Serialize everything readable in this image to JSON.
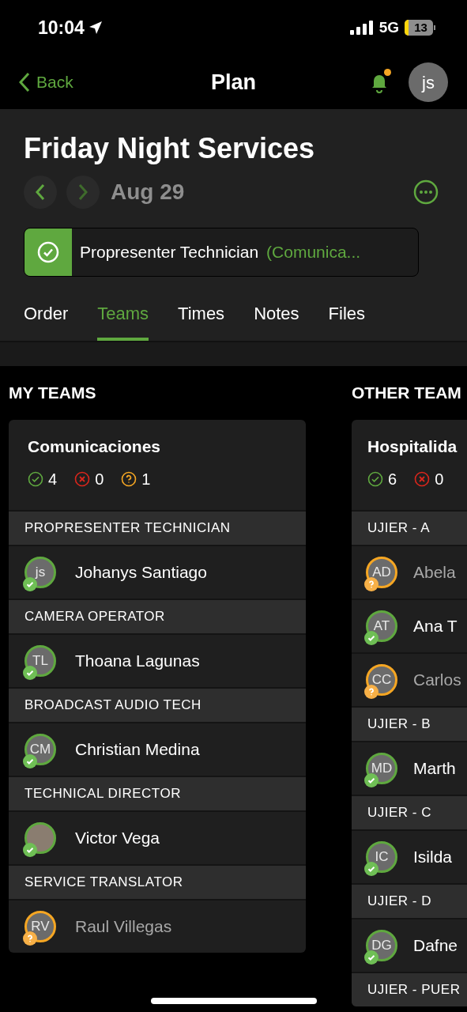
{
  "status_bar": {
    "time": "10:04",
    "network": "5G",
    "battery": "13"
  },
  "nav": {
    "back": "Back",
    "title": "Plan",
    "avatar": "js",
    "notification": true
  },
  "plan": {
    "title": "Friday Night Services",
    "date": "Aug 29",
    "date_nav": [
      {
        "kind": "prev",
        "disabled": false
      },
      {
        "kind": "next",
        "disabled": true
      }
    ],
    "assignment": {
      "kind": "confirmed",
      "position": "Propresenter Technician",
      "team": "(Comunica..."
    }
  },
  "tabs": [
    {
      "label": "Order",
      "selected": false
    },
    {
      "label": "Teams",
      "selected": true
    },
    {
      "label": "Times",
      "selected": false
    },
    {
      "label": "Notes",
      "selected": false
    },
    {
      "label": "Files",
      "selected": false
    }
  ],
  "columns": [
    {
      "heading": "MY TEAMS",
      "teams": [
        {
          "name": "Comunicaciones",
          "counts": [
            {
              "kind": "confirmed",
              "value": "4"
            },
            {
              "kind": "declined",
              "value": "0"
            },
            {
              "kind": "pending",
              "value": "1"
            }
          ],
          "positions": [
            {
              "name": "PROPRESENTER TECHNICIAN",
              "members": [
                {
                  "name": "Johanys Santiago",
                  "initials": "js",
                  "kind": "confirmed",
                  "photo": false
                }
              ]
            },
            {
              "name": "CAMERA OPERATOR",
              "members": [
                {
                  "name": "Thoana Lagunas",
                  "initials": "TL",
                  "kind": "confirmed",
                  "photo": false
                }
              ]
            },
            {
              "name": "BROADCAST AUDIO TECH",
              "members": [
                {
                  "name": "Christian Medina",
                  "initials": "CM",
                  "kind": "confirmed",
                  "photo": false
                }
              ]
            },
            {
              "name": "TECHNICAL DIRECTOR",
              "members": [
                {
                  "name": "Victor Vega",
                  "kind": "confirmed",
                  "photo": true
                }
              ]
            },
            {
              "name": "SERVICE TRANSLATOR",
              "members": [
                {
                  "name": "Raul Villegas",
                  "initials": "RV",
                  "kind": "pending",
                  "photo": false
                }
              ]
            }
          ]
        }
      ]
    },
    {
      "heading": "OTHER TEAM",
      "teams": [
        {
          "name": "Hospitalida",
          "counts": [
            {
              "kind": "confirmed",
              "value": "6"
            },
            {
              "kind": "declined",
              "value": "0"
            }
          ],
          "positions": [
            {
              "name": "UJIER - A",
              "members": [
                {
                  "name": "Abela",
                  "initials": "AD",
                  "kind": "pending",
                  "photo": false
                },
                {
                  "name": "Ana T",
                  "initials": "AT",
                  "kind": "confirmed",
                  "photo": false
                },
                {
                  "name": "Carlos",
                  "initials": "CC",
                  "kind": "pending",
                  "photo": false
                }
              ]
            },
            {
              "name": "UJIER - B",
              "members": [
                {
                  "name": "Marth",
                  "initials": "MD",
                  "kind": "confirmed",
                  "photo": false
                }
              ]
            },
            {
              "name": "UJIER - C",
              "members": [
                {
                  "name": "Isilda",
                  "initials": "IC",
                  "kind": "confirmed",
                  "photo": false
                }
              ]
            },
            {
              "name": "UJIER - D",
              "members": [
                {
                  "name": "Dafne",
                  "initials": "DG",
                  "kind": "confirmed",
                  "photo": false
                }
              ]
            },
            {
              "name": "UJIER - PUER"
            }
          ]
        }
      ]
    }
  ]
}
